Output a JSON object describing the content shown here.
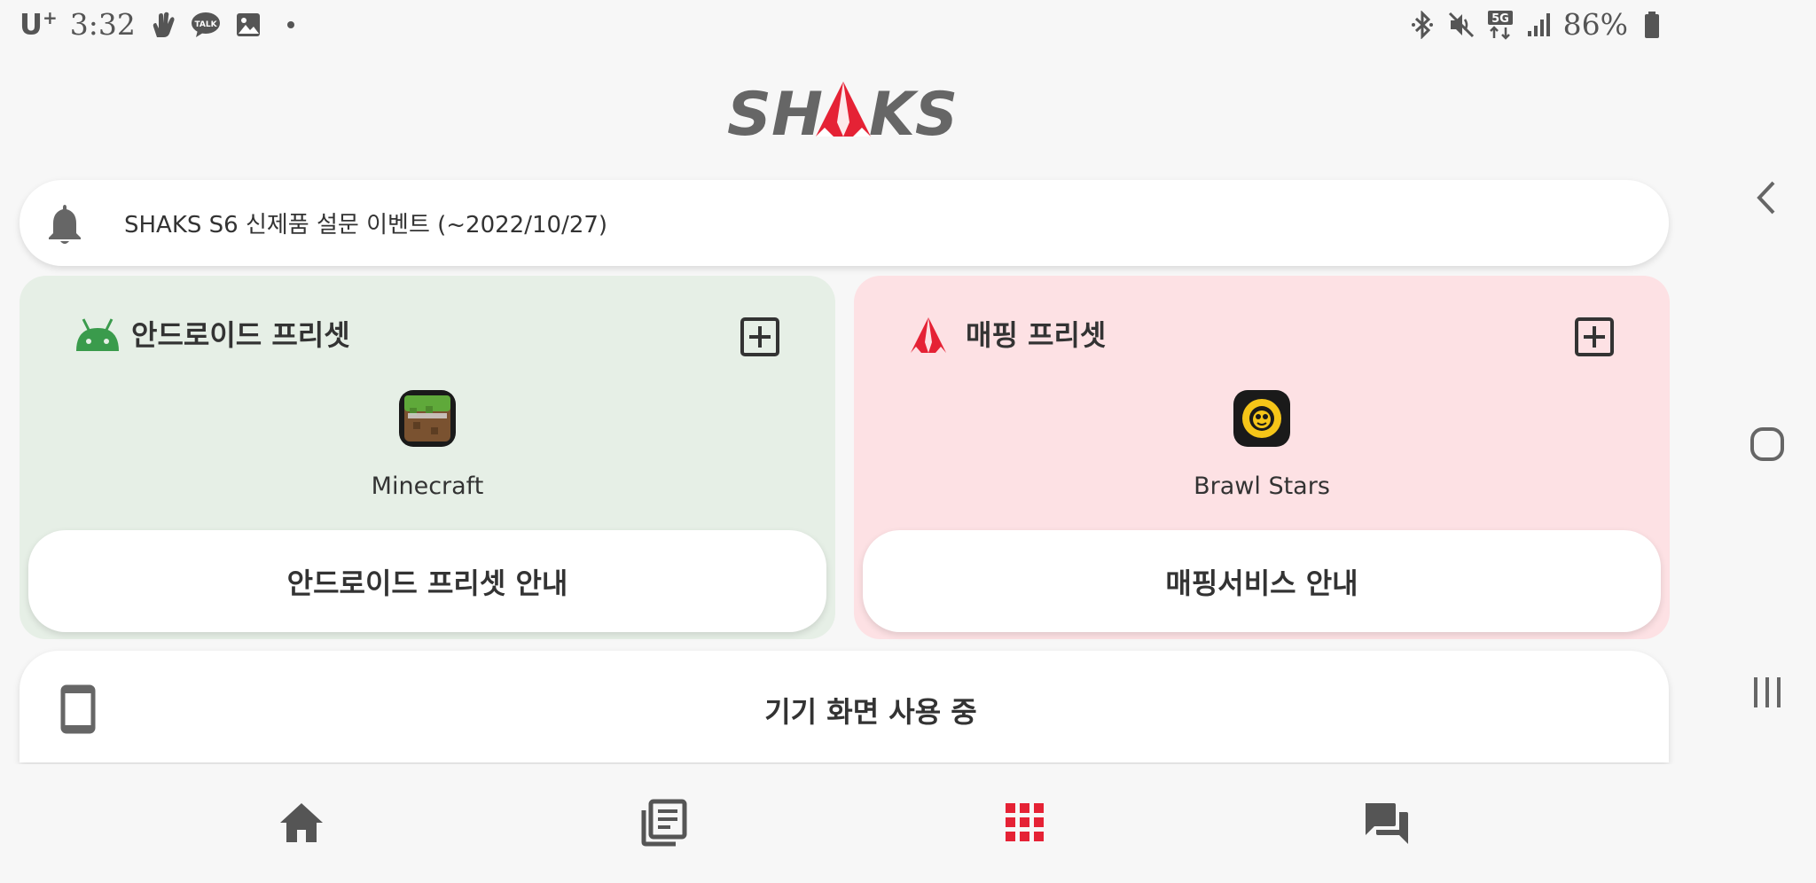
{
  "status_bar": {
    "carrier": "U",
    "carrier_sup": "+",
    "time": "3:32",
    "battery": "86%",
    "left_icons": [
      "hand-wave-icon",
      "kakaotalk-icon",
      "image-icon",
      "dot-icon"
    ],
    "right_icons": [
      "bluetooth-icon",
      "mute-icon",
      "5g-icon",
      "signal-icon",
      "battery-icon"
    ],
    "network": "5G",
    "kakao_label": "TALK"
  },
  "logo": {
    "text": "SHAKS"
  },
  "notice": {
    "icon": "bell-icon",
    "text": "SHAKS S6 신제품 설문 이벤트 (~2022/10/27)"
  },
  "android_preset": {
    "title": "안드로이드 프리셋",
    "icon": "android-icon",
    "app_name": "Minecraft",
    "guide_label": "안드로이드 프리셋 안내",
    "bg_color": "#e6efe6",
    "accent": "#3ddc84"
  },
  "mapping_preset": {
    "title": "매핑 프리셋",
    "icon": "shaks-triangle-icon",
    "app_name": "Brawl Stars",
    "guide_label": "매핑서비스 안내",
    "bg_color": "#fde1e4",
    "accent": "#e52235"
  },
  "device_screen": {
    "icon": "phone-icon",
    "label": "기기 화면 사용 중"
  },
  "bottom_nav": [
    {
      "name": "home",
      "icon": "home-icon",
      "active": false
    },
    {
      "name": "library",
      "icon": "library-icon",
      "active": false
    },
    {
      "name": "apps",
      "icon": "grid-icon",
      "active": true
    },
    {
      "name": "chat",
      "icon": "forum-icon",
      "active": false
    }
  ],
  "system_nav": [
    "back-icon",
    "home-circle-icon",
    "recents-icon"
  ],
  "colors": {
    "brand_red": "#e52235",
    "icon_gray": "#555555",
    "background": "#f7f7f7"
  }
}
